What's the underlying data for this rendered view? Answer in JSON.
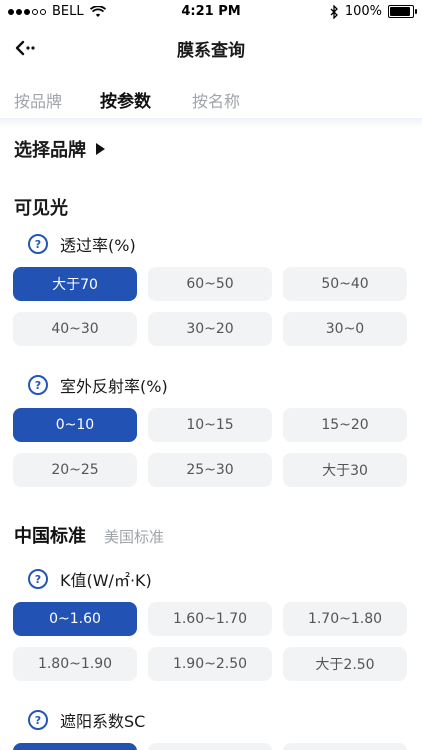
{
  "status_bar": {
    "carrier": "BELL",
    "time": "4:21 PM",
    "battery_percent": "100%",
    "battery_level": 1.0,
    "signal_bars_filled": 3,
    "signal_bars_total": 5
  },
  "nav": {
    "title": "膜系查询",
    "back_icon": "back-arrow-icon"
  },
  "tabs": [
    {
      "label": "按品牌",
      "active": false
    },
    {
      "label": "按参数",
      "active": true
    },
    {
      "label": "按名称",
      "active": false
    }
  ],
  "brand_selector": {
    "label": "选择品牌"
  },
  "visible_light": {
    "title": "可见光",
    "transmittance": {
      "label": "透过率(%)",
      "options": [
        "大于70",
        "60~50",
        "50~40",
        "40~30",
        "30~20",
        "30~0"
      ],
      "selected_index": 0
    },
    "reflectance": {
      "label": "室外反射率(%)",
      "options": [
        "0~10",
        "10~15",
        "15~20",
        "20~25",
        "25~30",
        "大于30"
      ],
      "selected_index": 0
    }
  },
  "standards": {
    "tabs": [
      {
        "label": "中国标准",
        "active": true
      },
      {
        "label": "美国标准",
        "active": false
      }
    ],
    "k_value": {
      "label": "K值(W/㎡·K)",
      "options": [
        "0~1.60",
        "1.60~1.70",
        "1.70~1.80",
        "1.80~1.90",
        "1.90~2.50",
        "大于2.50"
      ],
      "selected_index": 0
    },
    "shading": {
      "label": "遮阳系数SC"
    }
  },
  "colors": {
    "accent": "#2152b4",
    "option_bg": "#f2f3f5",
    "muted_text": "#a0a4ab"
  }
}
